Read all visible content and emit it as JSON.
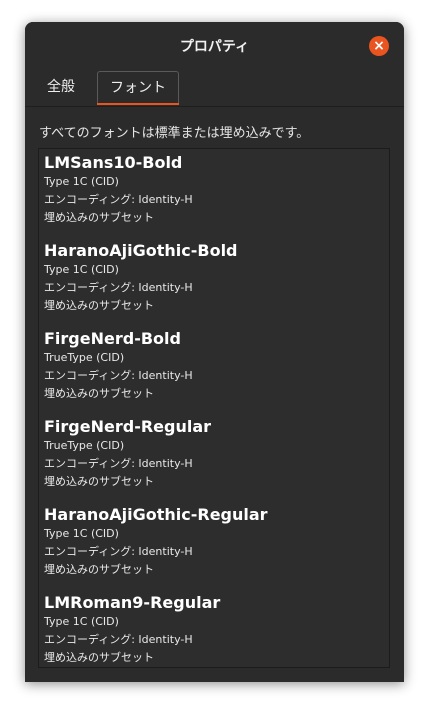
{
  "window": {
    "title": "プロパティ",
    "close_icon": "close-icon"
  },
  "tabs": [
    {
      "label": "全般",
      "selected": false
    },
    {
      "label": "フォント",
      "selected": true
    }
  ],
  "fonts_page": {
    "summary": "すべてのフォントは標準または埋め込みです。",
    "fonts": [
      {
        "name": "LMSans10-Bold",
        "type": "Type 1C (CID)",
        "encoding": "エンコーディング: Identity-H",
        "embedding": "埋め込みのサブセット"
      },
      {
        "name": "HaranoAjiGothic-Bold",
        "type": "Type 1C (CID)",
        "encoding": "エンコーディング: Identity-H",
        "embedding": "埋め込みのサブセット"
      },
      {
        "name": "FirgeNerd-Bold",
        "type": "TrueType (CID)",
        "encoding": "エンコーディング: Identity-H",
        "embedding": "埋め込みのサブセット"
      },
      {
        "name": "FirgeNerd-Regular",
        "type": "TrueType (CID)",
        "encoding": "エンコーディング: Identity-H",
        "embedding": "埋め込みのサブセット"
      },
      {
        "name": "HaranoAjiGothic-Regular",
        "type": "Type 1C (CID)",
        "encoding": "エンコーディング: Identity-H",
        "embedding": "埋め込みのサブセット"
      },
      {
        "name": "LMRoman9-Regular",
        "type": "Type 1C (CID)",
        "encoding": "エンコーディング: Identity-H",
        "embedding": "埋め込みのサブセット"
      }
    ]
  },
  "colors": {
    "accent": "#e95420",
    "window_bg": "#2b2b2b",
    "text": "#ffffff"
  }
}
